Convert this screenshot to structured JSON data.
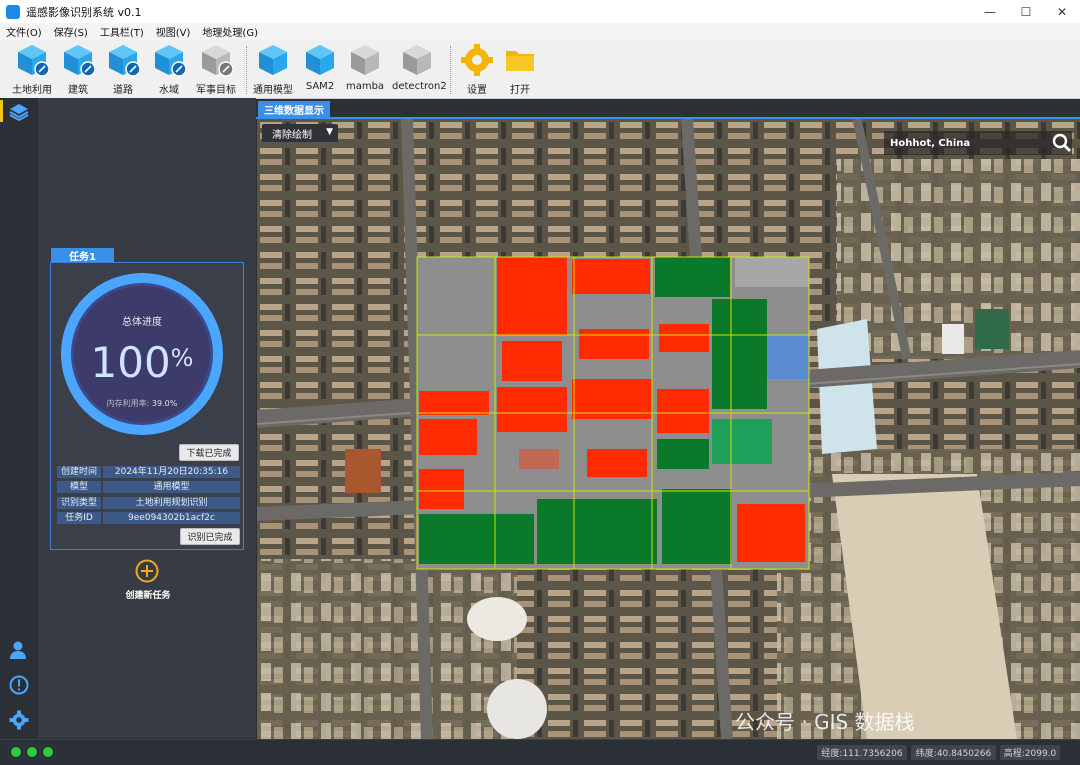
{
  "window": {
    "title": "遥感影像识别系统 v0.1",
    "controls": {
      "minimize": "—",
      "maximize": "☐",
      "close": "✕"
    }
  },
  "menu": [
    "文件(O)",
    "保存(S)",
    "工具栏(T)",
    "视图(V)",
    "地理处理(G)"
  ],
  "toolbar": {
    "tasks": [
      {
        "label": "土地利用",
        "icon": "blue-cube-icon"
      },
      {
        "label": "建筑",
        "icon": "blue-cube-icon"
      },
      {
        "label": "道路",
        "icon": "blue-cube-icon"
      },
      {
        "label": "水域",
        "icon": "blue-cube-icon"
      },
      {
        "label": "军事目标",
        "icon": "gray-cube-icon"
      }
    ],
    "models": [
      {
        "label": "通用模型",
        "icon": "blue-cube-icon"
      },
      {
        "label": "SAM2",
        "icon": "blue-cube-icon"
      },
      {
        "label": "mamba",
        "icon": "gray-cube-icon"
      },
      {
        "label": "detectron2",
        "icon": "gray-cube-icon"
      }
    ],
    "settings_label": "设置",
    "open_label": "打开"
  },
  "task_panel": {
    "tab_label": "任务1",
    "progress": {
      "title": "总体进度",
      "value": "100",
      "unit": "%",
      "fraction": 1.0,
      "memory_label": "内存利用率:",
      "memory_value": "39.0%"
    },
    "download_label": "下载已完成",
    "rows": [
      {
        "key": "创建时间",
        "value": "2024年11月20日20:35:16"
      },
      {
        "key": "模型",
        "value": "通用模型"
      },
      {
        "key": "识别类型",
        "value": "土地利用规划识别"
      },
      {
        "key": "任务ID",
        "value": "9ee094302b1acf2c"
      }
    ],
    "identify_label": "识别已完成"
  },
  "new_task_label": "创建新任务",
  "main": {
    "tab_label": "三维数据显示",
    "clear_select": "清除绘制",
    "search_value": "Hohhot, China"
  },
  "watermark": "公众号 · GIS 数据栈",
  "status": {
    "lng": "经度:111.7356206",
    "lat": "纬度:40.8450266",
    "alt": "高程:2099.0"
  },
  "colors": {
    "accent": "#3a8fe8",
    "panel": "#363b44",
    "ring": "#4aa6ff",
    "building_overlay": "#ff2a00",
    "vegetation_overlay": "#0a7a2a",
    "status_dot": "#2ecc40"
  }
}
